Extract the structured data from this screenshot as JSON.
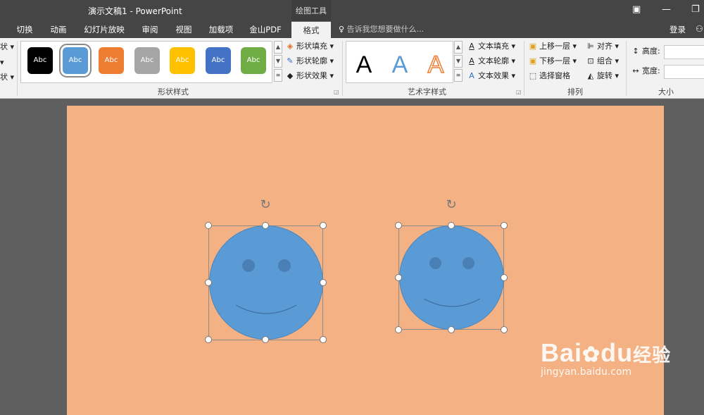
{
  "titlebar": {
    "title": "演示文稿1 - PowerPoint",
    "context_tab_title": "绘图工具",
    "restore_glyph": "▣",
    "minimize_glyph": "—",
    "maximize_glyph": "❐"
  },
  "tabs": [
    "切换",
    "动画",
    "幻灯片放映",
    "审阅",
    "视图",
    "加载项",
    "金山PDF",
    "格式"
  ],
  "active_tab": "格式",
  "tell_me": "告诉我您想要做什么...",
  "login": "登录",
  "left_clip": [
    "状 ▾",
    "▾",
    "状 ▾"
  ],
  "shape_styles": {
    "group_label": "形状样式",
    "swatches": [
      {
        "label": "Abc",
        "color": "#000000"
      },
      {
        "label": "Abc",
        "color": "#5b9bd5"
      },
      {
        "label": "Abc",
        "color": "#ed7d31"
      },
      {
        "label": "Abc",
        "color": "#a5a5a5"
      },
      {
        "label": "Abc",
        "color": "#ffc000"
      },
      {
        "label": "Abc",
        "color": "#4472c4"
      },
      {
        "label": "Abc",
        "color": "#70ad47"
      }
    ],
    "fill": "形状填充 ▾",
    "outline": "形状轮廓 ▾",
    "effects": "形状效果 ▾"
  },
  "wordart": {
    "group_label": "艺术字样式",
    "letters": [
      "A",
      "A",
      "A"
    ],
    "text_fill": "文本填充 ▾",
    "text_outline": "文本轮廓 ▾",
    "text_effects": "文本效果 ▾"
  },
  "arrange": {
    "group_label": "排列",
    "bring_forward": "上移一层",
    "send_backward": "下移一层",
    "selection_pane": "选择窗格",
    "align": "对齐 ▾",
    "group": "组合 ▾",
    "rotate": "旋转 ▾"
  },
  "size": {
    "group_label": "大小",
    "height": "高度:",
    "width": "宽度:"
  },
  "icons": {
    "rotate_handle": "↻",
    "lightbulb": "💡",
    "user": "👤"
  },
  "watermark": {
    "brand": "Bai",
    "brand2": "du",
    "cn": "经验",
    "url": "jingyan.baidu.com"
  },
  "colors": {
    "slide_bg": "#f4b183",
    "face_fill": "#5b9bd5",
    "ribbon_bg": "#f2f2f2",
    "title_bg": "#454545"
  }
}
